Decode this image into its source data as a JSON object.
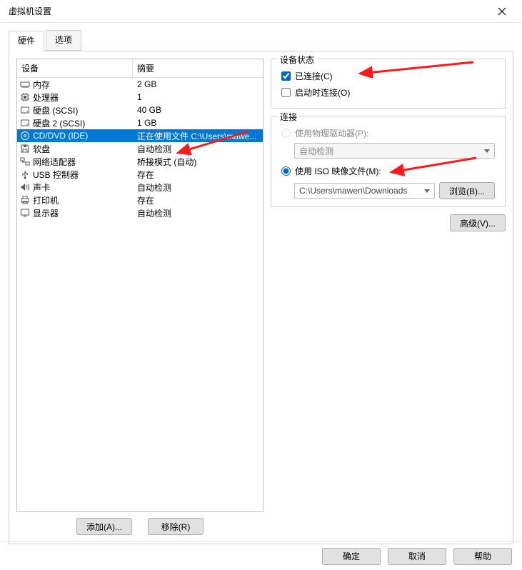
{
  "window": {
    "title": "虚拟机设置"
  },
  "tabs": [
    {
      "label": "硬件",
      "active": true
    },
    {
      "label": "选项",
      "active": false
    }
  ],
  "deviceTable": {
    "headers": {
      "device": "设备",
      "summary": "摘要"
    },
    "rows": [
      {
        "icon": "memory",
        "name": "内存",
        "summary": "2 GB",
        "selected": false
      },
      {
        "icon": "cpu",
        "name": "处理器",
        "summary": "1",
        "selected": false
      },
      {
        "icon": "disk",
        "name": "硬盘 (SCSI)",
        "summary": "40 GB",
        "selected": false
      },
      {
        "icon": "disk",
        "name": "硬盘 2 (SCSI)",
        "summary": "1 GB",
        "selected": false
      },
      {
        "icon": "cd",
        "name": "CD/DVD (IDE)",
        "summary": "正在使用文件 C:\\Users\\mawe...",
        "selected": true
      },
      {
        "icon": "floppy",
        "name": "软盘",
        "summary": "自动检测",
        "selected": false
      },
      {
        "icon": "network",
        "name": "网络适配器",
        "summary": "桥接模式 (自动)",
        "selected": false
      },
      {
        "icon": "usb",
        "name": "USB 控制器",
        "summary": "存在",
        "selected": false
      },
      {
        "icon": "sound",
        "name": "声卡",
        "summary": "自动检测",
        "selected": false
      },
      {
        "icon": "printer",
        "name": "打印机",
        "summary": "存在",
        "selected": false
      },
      {
        "icon": "display",
        "name": "显示器",
        "summary": "自动检测",
        "selected": false
      }
    ]
  },
  "leftButtons": {
    "add": "添加(A)...",
    "remove": "移除(R)"
  },
  "status": {
    "title": "设备状态",
    "connected": {
      "label": "已连接(C)",
      "checked": true
    },
    "connectOnPowerOn": {
      "label": "启动时连接(O)",
      "checked": false
    }
  },
  "connection": {
    "title": "连接",
    "physical": {
      "label": "使用物理驱动器(P):",
      "checked": false,
      "enabled": false,
      "comboValue": "自动检测"
    },
    "iso": {
      "label": "使用 ISO 映像文件(M):",
      "checked": true,
      "comboValue": "C:\\Users\\mawen\\Downloads",
      "browse": "浏览(B)..."
    }
  },
  "advanced": "高级(V)...",
  "footer": {
    "ok": "确定",
    "cancel": "取消",
    "help": "帮助"
  }
}
